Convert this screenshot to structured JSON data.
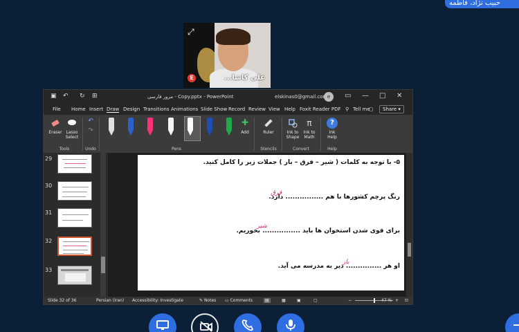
{
  "participant_badge": "حبیب نژاد، فاطمه",
  "webcam": {
    "name": "علی کاشا..."
  },
  "window": {
    "title": "مرور فارسی - Copy.pptx - PowerPoint",
    "account_email": "elskinas0@gmail.com",
    "avatar_initial": "e"
  },
  "menu": {
    "items": [
      "File",
      "Home",
      "Insert",
      "Draw",
      "Design",
      "Transitions",
      "Animations",
      "Slide Show",
      "Record",
      "Review",
      "View",
      "Help",
      "Foxit Reader PDF"
    ],
    "active": "Draw",
    "tell_me": "Tell me",
    "share": "Share"
  },
  "ribbon": {
    "eraser": "Eraser",
    "lasso": "Lasso Select",
    "tools_group": "Tools",
    "undo_group": "Undo",
    "pens_group": "Pens",
    "add": "Add",
    "ruler": "Ruler",
    "stencils_group": "Stencils",
    "ink_to_shape": "Ink to Shape",
    "ink_to_math": "Ink to Math",
    "convert_group": "Convert",
    "ink_help": "Ink Help",
    "help_group": "Help",
    "pen_colors": [
      "#e0e0e0",
      "#2a62c9",
      "#ff2f7a",
      "#f5f5f5",
      "#ffffff",
      "#1f4fb5",
      "#20a84a"
    ]
  },
  "thumbnails": [
    {
      "num": "29",
      "selected": false
    },
    {
      "num": "30",
      "selected": false
    },
    {
      "num": "31",
      "selected": false
    },
    {
      "num": "32",
      "selected": true
    },
    {
      "num": "33",
      "selected": false
    }
  ],
  "slide": {
    "line1": "۵- با توجه به کلمات ( شیر – فرق – بار ) جملات زیر را کامل کنید.",
    "line2": "رنگ پرچم کشورها با هم ................ دارد.",
    "line3": "برای قوی شدن استخوان ها باید ................ بخوریم.",
    "line4": "او هر ............... دیر به مدرسه می آید.",
    "ink2": "فرق",
    "ink3": "شیر",
    "ink4": "بار"
  },
  "statusbar": {
    "slide_counter": "Slide 32 of 36",
    "language": "Persian (Iran)",
    "accessibility": "Accessibility: Investigate",
    "notes": "Notes",
    "comments": "Comments",
    "zoom": "47 %"
  },
  "controls": [
    "screen-share",
    "camera-off",
    "phone",
    "microphone"
  ]
}
